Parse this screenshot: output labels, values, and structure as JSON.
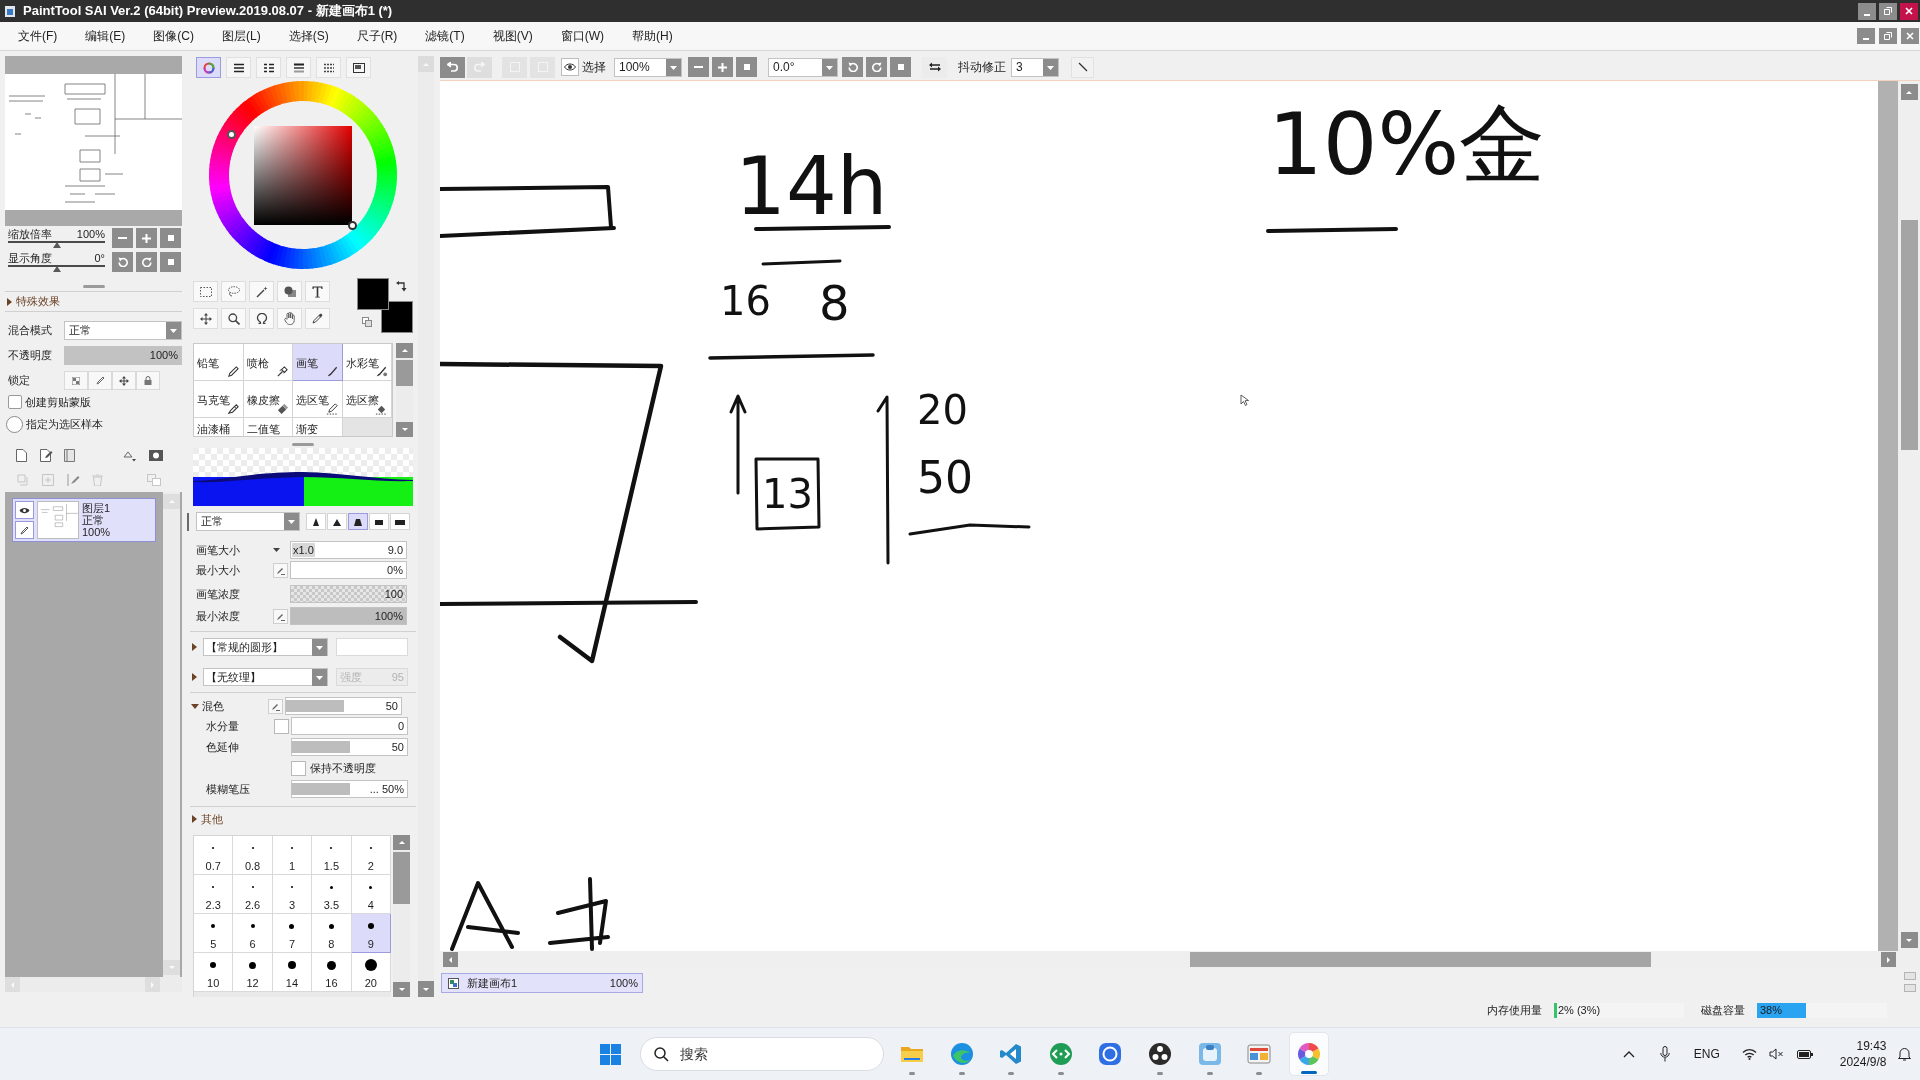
{
  "window": {
    "title": "PaintTool SAI Ver.2 (64bit) Preview.2019.08.07 - 新建画布1 (*)"
  },
  "menu": [
    "文件(F)",
    "编辑(E)",
    "图像(C)",
    "图层(L)",
    "选择(S)",
    "尺子(R)",
    "滤镜(T)",
    "视图(V)",
    "窗口(W)",
    "帮助(H)"
  ],
  "toolbar": {
    "undo_enabled": true,
    "redo_enabled": false,
    "selection_label": "选择",
    "zoom": "100%",
    "angle": "0.0°",
    "stabilizer_label": "抖动修正",
    "stabilizer": "3"
  },
  "navigator": {
    "zoom": {
      "label": "缩放倍率",
      "value": "100%",
      "level": 0.5
    },
    "angle": {
      "label": "显示角度",
      "value": "0°",
      "level": 0.5
    }
  },
  "layer_panel": {
    "effects": {
      "label": "特殊效果",
      "expanded": false
    },
    "blend_mode": {
      "label": "混合模式",
      "value": "正常"
    },
    "opacity": {
      "label": "不透明度",
      "value": "100%",
      "level": 1
    },
    "lock": {
      "label": "锁定"
    },
    "clipping_mask": {
      "label": "创建剪贴蒙版",
      "checked": false
    },
    "selection_source": {
      "label": "指定为选区样本",
      "checked": false
    },
    "layers": [
      {
        "name": "图层1",
        "mode": "正常",
        "opacity": "100%",
        "selected": true,
        "visible": true
      }
    ]
  },
  "color_panel": {
    "tabs": [
      {
        "kind": "wheel",
        "selected": true
      },
      {
        "kind": "bars",
        "selected": false
      },
      {
        "kind": "list",
        "selected": false
      },
      {
        "kind": "stripes",
        "selected": false
      },
      {
        "kind": "grid",
        "selected": false
      },
      {
        "kind": "picture",
        "selected": false
      }
    ]
  },
  "brush_tools": [
    {
      "label": "铅笔",
      "kind": "pencil",
      "selected": false
    },
    {
      "label": "喷枪",
      "kind": "airbrush",
      "selected": false
    },
    {
      "label": "画笔",
      "kind": "brush",
      "selected": true
    },
    {
      "label": "水彩笔",
      "kind": "watercolor",
      "selected": false
    },
    {
      "label": "马克笔",
      "kind": "marker",
      "selected": false
    },
    {
      "label": "橡皮擦",
      "kind": "eraser",
      "selected": false
    },
    {
      "label": "选区笔",
      "kind": "select-pen",
      "selected": false
    },
    {
      "label": "选区擦",
      "kind": "select-eraser",
      "selected": false
    },
    {
      "label": "油漆桶",
      "kind": "bucket",
      "selected": false
    },
    {
      "label": "二值笔",
      "kind": "binary",
      "selected": false
    },
    {
      "label": "渐变",
      "kind": "gradient",
      "selected": false
    }
  ],
  "brush": {
    "mode": "正常",
    "tips": [
      {
        "selected": false
      },
      {
        "selected": false
      },
      {
        "selected": true
      },
      {
        "selected": false
      },
      {
        "selected": false
      }
    ],
    "size": {
      "label": "画笔大小",
      "multiplier": "x1.0",
      "value": "9.0"
    },
    "min_size": {
      "label": "最小大小",
      "value": "0%",
      "level": 0
    },
    "density": {
      "label": "画笔浓度",
      "value": "100",
      "level": 1
    },
    "min_density": {
      "label": "最小浓度",
      "value": "100%",
      "level": 1
    },
    "shape": {
      "value": "【常规的圆形】",
      "expanded": false
    },
    "texture": {
      "value": "【无纹理】",
      "expanded": false,
      "strength_label": "强度",
      "strength": "95"
    },
    "mixing": {
      "label": "混色",
      "expanded": true,
      "value": "50",
      "level": 0.5
    },
    "water": {
      "label": "水分量",
      "checked": false,
      "value": "0",
      "level": 0
    },
    "blend": {
      "label": "色延伸",
      "value": "50",
      "level": 0.5
    },
    "keep_opacity": {
      "label": "保持不透明度",
      "checked": false
    },
    "blur": {
      "label": "模糊笔压",
      "value": "... 50%",
      "level": 0.5
    },
    "other": {
      "label": "其他",
      "expanded": false
    }
  },
  "brush_sizes": [
    {
      "label": "0.7",
      "selected": false
    },
    {
      "label": "0.8",
      "selected": false
    },
    {
      "label": "1",
      "selected": false
    },
    {
      "label": "1.5",
      "selected": false
    },
    {
      "label": "2",
      "selected": false
    },
    {
      "label": "2.3",
      "selected": false
    },
    {
      "label": "2.6",
      "selected": false
    },
    {
      "label": "3",
      "selected": false
    },
    {
      "label": "3.5",
      "selected": false
    },
    {
      "label": "4",
      "selected": false
    },
    {
      "label": "5",
      "selected": false
    },
    {
      "label": "6",
      "selected": false
    },
    {
      "label": "7",
      "selected": false
    },
    {
      "label": "8",
      "selected": false
    },
    {
      "label": "9",
      "selected": true
    },
    {
      "label": "10",
      "selected": false
    },
    {
      "label": "12",
      "selected": false
    },
    {
      "label": "14",
      "selected": false
    },
    {
      "label": "16",
      "selected": false
    },
    {
      "label": "20",
      "selected": false
    }
  ],
  "canvas": {
    "handwriting": [
      "14h",
      "16",
      "8",
      "13",
      "20",
      "50",
      "10%金"
    ]
  },
  "canvas_tab": {
    "name": "新建画布1",
    "zoom": "100%",
    "selected": true
  },
  "status": {
    "memory": {
      "label": "内存使用量",
      "value": "2% (3%)",
      "level": 0.02
    },
    "disk": {
      "label": "磁盘容量",
      "value": "38%",
      "level": 0.38
    }
  },
  "taskbar": {
    "search_placeholder": "搜索",
    "apps": [
      {
        "kind": "folder",
        "running": true,
        "selected": false
      },
      {
        "kind": "browser",
        "running": true,
        "selected": false
      },
      {
        "kind": "code-editor",
        "running": true,
        "selected": false
      },
      {
        "kind": "code-circle",
        "running": true,
        "selected": false
      },
      {
        "kind": "ring",
        "running": false,
        "selected": false
      },
      {
        "kind": "dots",
        "running": true,
        "selected": false
      },
      {
        "kind": "tile",
        "running": true,
        "selected": false
      },
      {
        "kind": "window",
        "running": true,
        "selected": false
      },
      {
        "kind": "wheel",
        "running": true,
        "selected": true
      }
    ],
    "language": "ENG",
    "time": "19:43",
    "date": "2024/9/8"
  }
}
